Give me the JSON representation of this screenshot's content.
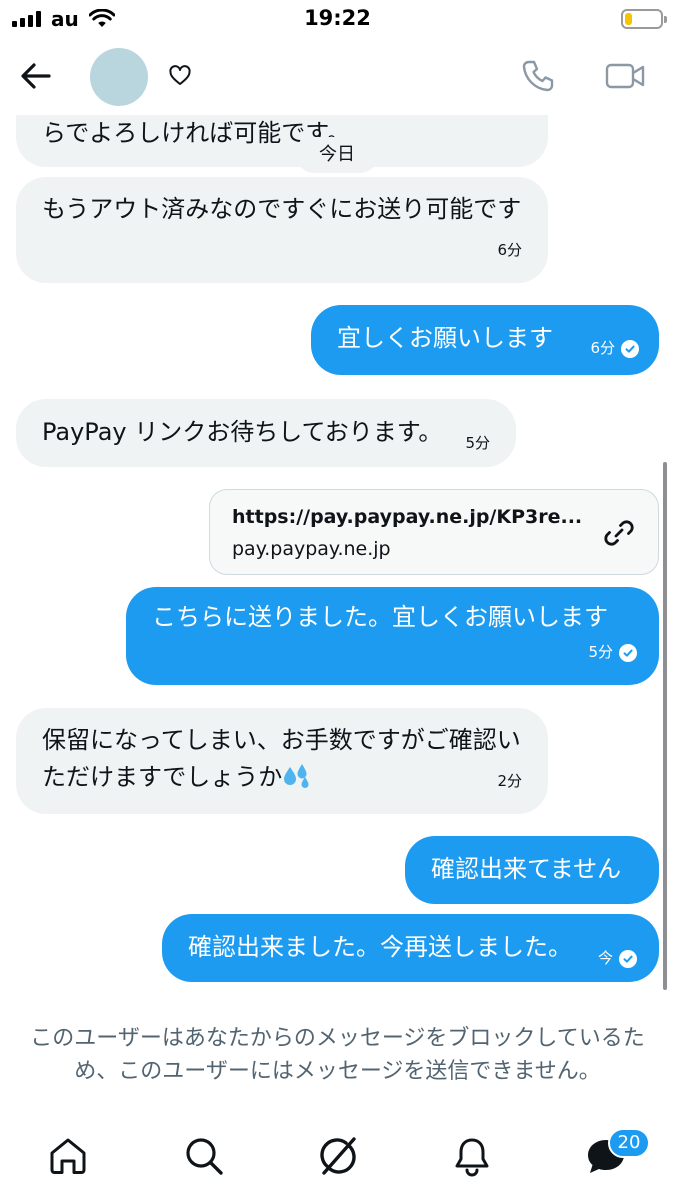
{
  "status_bar": {
    "carrier": "au",
    "time": "19:22",
    "battery_level": 0.2
  },
  "header": {
    "back_icon": "arrow-left-icon",
    "favorite_icon": "heart-icon",
    "call_icon": "phone-icon",
    "video_icon": "video-camera-icon"
  },
  "conversation": {
    "date_divider": "今日",
    "messages": [
      {
        "direction": "in",
        "text": "らでよろしければ可能です。",
        "time": ""
      },
      {
        "direction": "in",
        "text": "もうアウト済みなのですぐにお送り可能です",
        "time": "6分"
      },
      {
        "direction": "out",
        "text": "宜しくお願いします",
        "time": "6分",
        "read": true
      },
      {
        "direction": "in",
        "text": "PayPay リンクお待ちしております。",
        "time": "5分"
      },
      {
        "direction": "out",
        "text": "こちらに送りました。宜しくお願いします",
        "time": "5分",
        "read": true
      },
      {
        "direction": "in",
        "text": "保留になってしまい、お手数ですがご確認いただけますでしょうか",
        "emoji": "sweat-droplets",
        "time": "2分"
      },
      {
        "direction": "out",
        "text": "確認出来てません",
        "time": ""
      },
      {
        "direction": "out",
        "text": "確認出来ました。今再送しました。",
        "time": "今",
        "read": true
      }
    ],
    "link_card": {
      "url": "https://pay.paypay.ne.jp/KP3re...",
      "domain": "pay.paypay.ne.jp",
      "icon": "link-icon"
    }
  },
  "blocked_notice": "このユーザーはあなたからのメッセージをブロックしているため、このユーザーにはメッセージを送信できません。",
  "bottom_nav": {
    "items": [
      "home-icon",
      "search-icon",
      "grok-icon",
      "notifications-icon",
      "messages-icon"
    ],
    "messages_badge": "20"
  },
  "colors": {
    "accent": "#1d9bf0",
    "incoming_bubble": "#eff3f4",
    "muted_text": "#536471"
  }
}
